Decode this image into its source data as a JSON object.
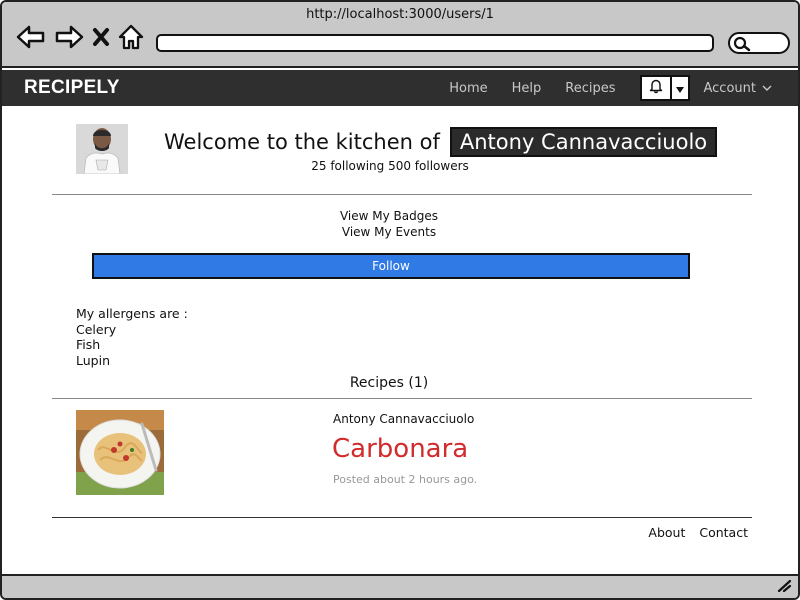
{
  "browser": {
    "url": "http://localhost:3000/users/1"
  },
  "nav": {
    "brand": "RECIPELY",
    "links": [
      "Home",
      "Help",
      "Recipes"
    ],
    "account_label": "Account"
  },
  "profile": {
    "welcome_text": "Welcome to the kitchen of",
    "name": "Antony Cannavacciuolo",
    "stats": "25 following 500 followers"
  },
  "actions": {
    "view_badges": "View My Badges",
    "view_events": "View My Events",
    "follow_label": "Follow"
  },
  "allergens": {
    "heading": "My allergens are :",
    "items": [
      "Celery",
      "Fish",
      "Lupin"
    ]
  },
  "recipes": {
    "heading": "Recipes (1)",
    "items": [
      {
        "author": "Antony Cannavacciuolo",
        "title": "Carbonara",
        "posted": "Posted about 2 hours ago."
      }
    ]
  },
  "footer": {
    "about": "About",
    "contact": "Contact"
  },
  "colors": {
    "follow_button": "#2f7ae5",
    "recipe_title": "#d12b2b",
    "navbar": "#2f2f2f"
  },
  "icons": [
    "back-icon",
    "forward-icon",
    "close-icon",
    "home-icon",
    "search-icon",
    "bell-icon",
    "caret-down-icon",
    "chevron-down-icon",
    "resize-grip-icon"
  ]
}
